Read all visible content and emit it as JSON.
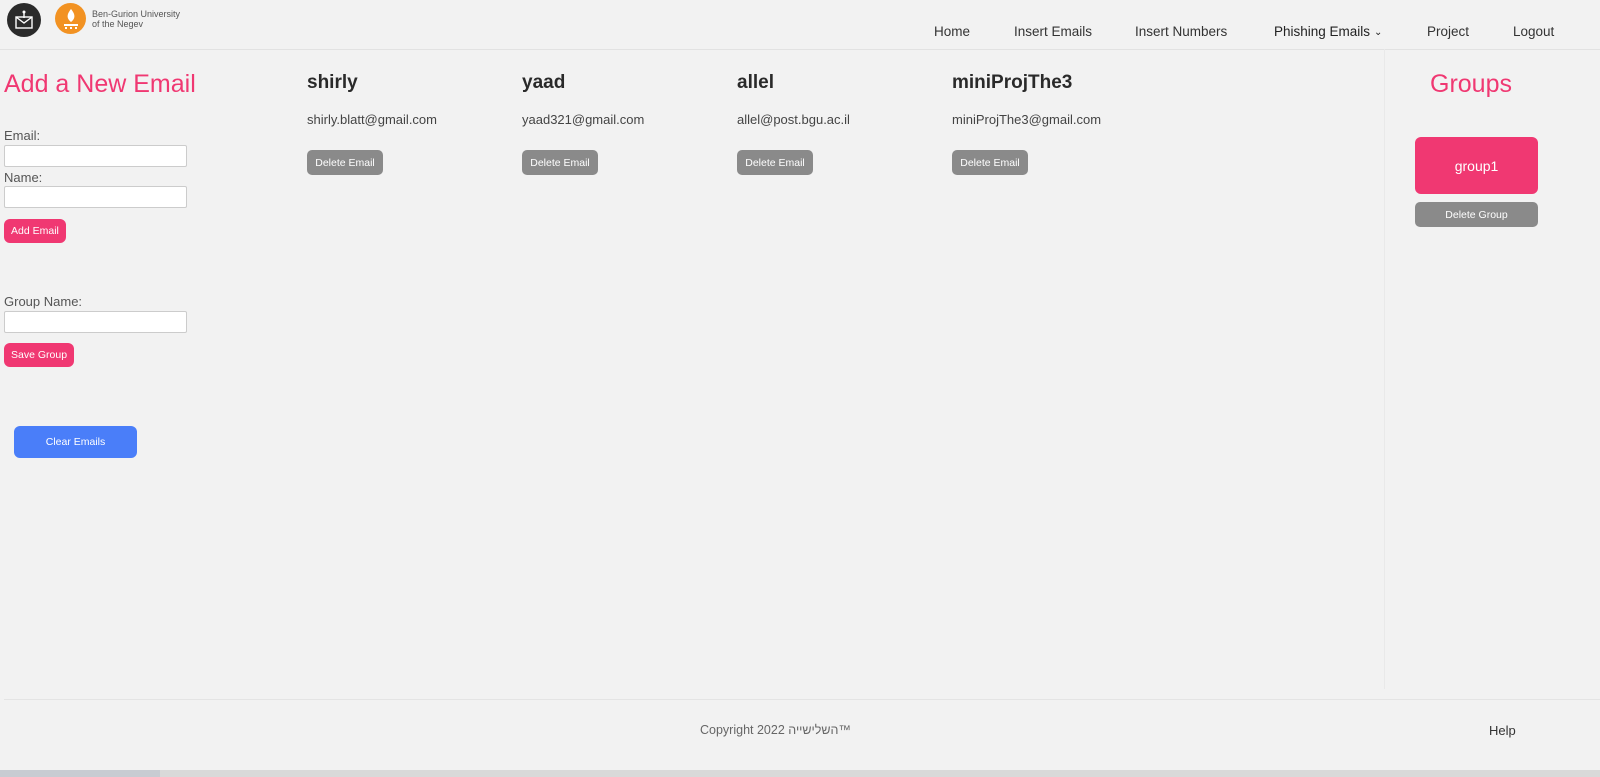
{
  "header": {
    "university_name_line1": "Ben-Gurion University",
    "university_name_line2": "of the Negev",
    "nav": {
      "home": "Home",
      "insert_emails": "Insert Emails",
      "insert_numbers": "Insert Numbers",
      "phishing_emails": "Phishing Emails",
      "project": "Project",
      "logout": "Logout"
    }
  },
  "add_email_form": {
    "title": "Add a New Email",
    "email_label": "Email:",
    "email_value": "",
    "name_label": "Name:",
    "name_value": "",
    "add_button": "Add Email",
    "group_name_label": "Group Name:",
    "group_name_value": "",
    "save_group_button": "Save Group",
    "clear_button": "Clear Emails"
  },
  "emails": [
    {
      "name": "shirly",
      "email": "shirly.blatt@gmail.com",
      "delete_label": "Delete Email"
    },
    {
      "name": "yaad",
      "email": "yaad321@gmail.com",
      "delete_label": "Delete Email"
    },
    {
      "name": "allel",
      "email": "allel@post.bgu.ac.il",
      "delete_label": "Delete Email"
    },
    {
      "name": "miniProjThe3",
      "email": "miniProjThe3@gmail.com",
      "delete_label": "Delete Email"
    }
  ],
  "groups": {
    "title": "Groups",
    "items": [
      {
        "name": "group1",
        "delete_label": "Delete Group"
      }
    ]
  },
  "footer": {
    "copyright": "Copyright 2022 השלישייה™",
    "help": "Help"
  },
  "colors": {
    "accent_pink": "#f03872",
    "button_gray": "#8a8a8a",
    "button_blue": "#4a7ef9",
    "background": "#f2f2f2"
  }
}
